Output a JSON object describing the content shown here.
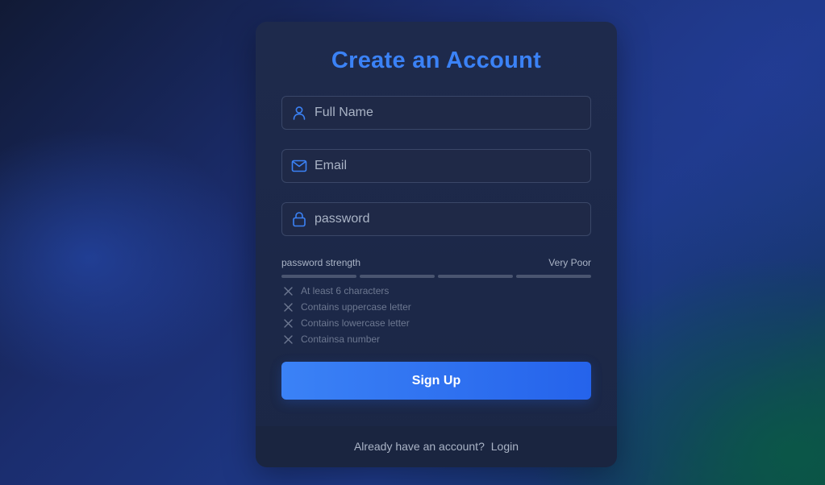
{
  "form": {
    "title": "Create an Account",
    "fields": [
      {
        "name": "full-name",
        "placeholder": "Full Name",
        "value": "",
        "icon": "user-icon"
      },
      {
        "name": "email",
        "placeholder": "Email",
        "value": "",
        "icon": "mail-icon"
      },
      {
        "name": "password",
        "placeholder": "password",
        "value": "",
        "icon": "lock-icon"
      }
    ],
    "strength": {
      "label": "password strength",
      "value": "Very Poor",
      "segments_filled": 0,
      "segments_total": 4
    },
    "requirements": [
      {
        "text": "At least 6 characters",
        "met": false
      },
      {
        "text": "Contains uppercase letter",
        "met": false
      },
      {
        "text": "Contains lowercase letter",
        "met": false
      },
      {
        "text": "Containsa number",
        "met": false
      }
    ],
    "submit_label": "Sign Up",
    "footer": {
      "prompt": "Already have an account?",
      "login_label": "Login"
    }
  },
  "colors": {
    "accent": "#3b82f6",
    "button_start": "#3b82f6",
    "button_end": "#2563eb",
    "card": "#1e2a4c",
    "muted_text": "#aab4c6",
    "requirement_text": "#6d7891",
    "strength_bar_empty": "#4a5570"
  }
}
